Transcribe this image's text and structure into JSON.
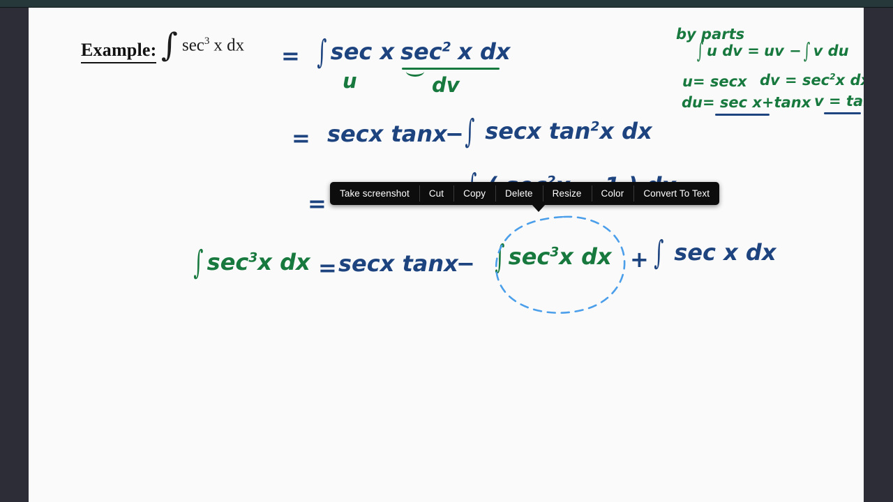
{
  "window": {
    "background_color": "#2d2d38",
    "topbar_color": "#27383a",
    "page_color": "#fafafa"
  },
  "ink": {
    "blue": "#1e4480",
    "green": "#18793f",
    "lasso": "#4a9eea"
  },
  "header": {
    "label": "Example:",
    "integral": "∫",
    "expression_pre": "sec",
    "expression_exp": "3",
    "expression_post": "x dx"
  },
  "work": {
    "line1": {
      "equals": "=",
      "integral": "∫",
      "u_term": "sec x",
      "u_label": "u",
      "dv_term_pre": "sec",
      "dv_term_exp": "2",
      "dv_term_post": "x dx",
      "dv_label": "dv"
    },
    "line2": {
      "equals": "=",
      "first": "secx tanx",
      "minus": "−",
      "integral": "∫",
      "rest_pre": "secx tan",
      "rest_exp": "2",
      "rest_post": "x dx"
    },
    "line3": {
      "equals": "=",
      "integral": "∫",
      "obscured_text": "( sec",
      "obscured_exp": "2",
      "obscured_post": "x − 1 ) dx"
    },
    "line4": {
      "lhs_integral": "∫",
      "lhs_pre": "sec",
      "lhs_exp": "3",
      "lhs_post": "x dx",
      "equals": "=",
      "mid": "secx tanx",
      "minus": "−",
      "sel_integral": "∫",
      "sel_pre": "sec",
      "sel_exp": "3",
      "sel_post": "x dx",
      "plus": "+",
      "last_integral": "∫",
      "last_text": "sec x dx"
    }
  },
  "notes": {
    "title": "by parts",
    "formula_integral1": "∫",
    "formula_a": "u dv =",
    "formula_b": "uv −",
    "formula_integral2": "∫",
    "formula_c": "v du",
    "u_line": "u= secx",
    "dv_line_pre": "dv = sec",
    "dv_line_exp": "2",
    "dv_line_post": "x  dx",
    "du_line": "du= sec x+tanx",
    "v_line": "v = tanx"
  },
  "context_menu": {
    "items": [
      {
        "label": "Take screenshot"
      },
      {
        "label": "Cut"
      },
      {
        "label": "Copy"
      },
      {
        "label": "Delete"
      },
      {
        "label": "Resize"
      },
      {
        "label": "Color"
      },
      {
        "label": "Convert To Text"
      }
    ]
  }
}
